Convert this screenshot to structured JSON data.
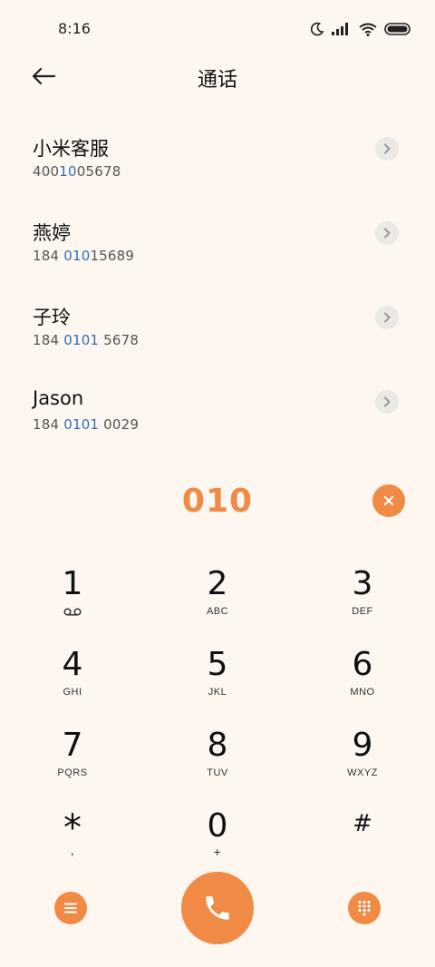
{
  "status": {
    "time": "8:16"
  },
  "header": {
    "title": "通话"
  },
  "contacts": [
    {
      "name": "小米客服",
      "number_pre": "400",
      "number_hl": "10",
      "number_post": "05678"
    },
    {
      "name": "燕婷",
      "number_pre": "184 ",
      "number_hl": "010",
      "number_post": "15689"
    },
    {
      "name": "子玲",
      "number_pre": "184 ",
      "number_hl": "0101",
      "number_post": " 5678"
    },
    {
      "name": "Jason",
      "number_pre": "184 ",
      "number_hl": "0101",
      "number_post": " 0029"
    }
  ],
  "dialer": {
    "entered": "010",
    "keys": [
      {
        "digit": "1",
        "sub": "voicemail"
      },
      {
        "digit": "2",
        "sub": "ABC"
      },
      {
        "digit": "3",
        "sub": "DEF"
      },
      {
        "digit": "4",
        "sub": "GHI"
      },
      {
        "digit": "5",
        "sub": "JKL"
      },
      {
        "digit": "6",
        "sub": "MNO"
      },
      {
        "digit": "7",
        "sub": "PQRS"
      },
      {
        "digit": "8",
        "sub": "TUV"
      },
      {
        "digit": "9",
        "sub": "WXYZ"
      },
      {
        "digit": "*",
        "sub": ","
      },
      {
        "digit": "0",
        "sub": "+"
      },
      {
        "digit": "#",
        "sub": ""
      }
    ]
  },
  "colors": {
    "accent": "#f08a45",
    "highlight": "#2f6fb3",
    "background": "#fdf7f0"
  }
}
